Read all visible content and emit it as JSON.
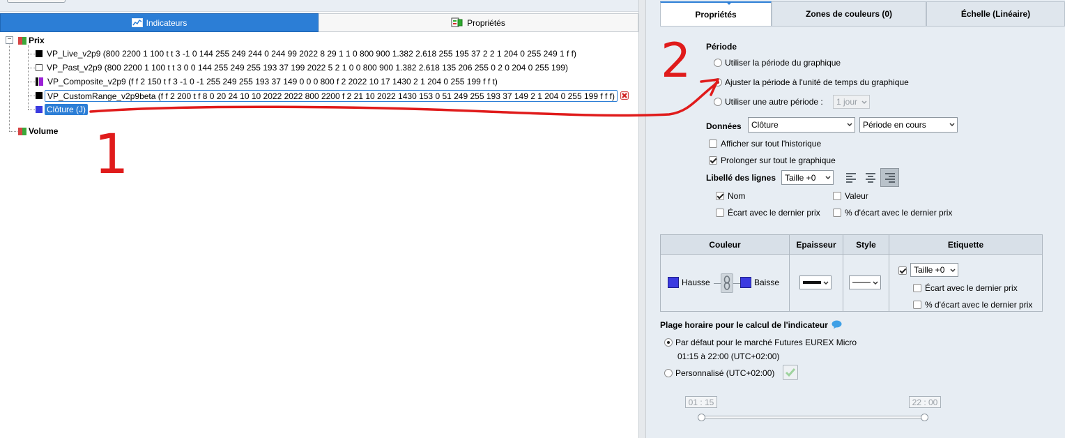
{
  "left_tabs": {
    "indicators": "Indicateurs",
    "properties": "Propriétés"
  },
  "tree": {
    "prix_label": "Prix",
    "prix_expander": "−",
    "volume_label": "Volume",
    "items": [
      {
        "label": "VP_Live_v2p9 (800 2200 1 100 t t 3 -1 0 144 255 249 244 0 244 99 2022 8 29 1 1 0 800 900 1.382 2.618 255 195 37 2 2 1 204 0 255 249 1 f f)",
        "swatch": "#000000"
      },
      {
        "label": "VP_Past_v2p9 (800 2200 1 100 t t 3 0 0 144 255 249 255 193 37 199 2022 5 2 1 0 0 800 900 1.382 2.618 135 206 255 0 2 0 204 0 255 199)",
        "swatch": "#ffffff"
      },
      {
        "label": "VP_Composite_v2p9 (f f 2 150 t f 3 -1 0 -1 255 249 255 193 37 149 0 0 0 800 f 2 2022 10 17 1430 2 1 204 0 255 199 f f t)",
        "swatch": "#9b20d6"
      },
      {
        "label": "VP_CustomRange_v2p9beta (f f 2 200 t f 8 0 20 24 10 10 2022 2022 800 2200 f 2 21 10 2022 1430 153 0 51 249 255 193 37 149 2 1 204 0 255 199 f f f)",
        "swatch": "#000000"
      },
      {
        "label": "Clôture (J)",
        "swatch": "#3b3be0"
      }
    ]
  },
  "right_tabs": {
    "props": "Propriétés",
    "zones": "Zones de couleurs (0)",
    "echelle": "Échelle (Linéaire)"
  },
  "periode": {
    "label": "Période",
    "opt1": "Utiliser la période du graphique",
    "opt2": "Ajuster la période à l'unité de temps du graphique",
    "opt3": "Utiliser une autre période :",
    "opt3_value": "1 jour"
  },
  "donnees": {
    "label": "Données",
    "source": "Clôture",
    "period": "Période en cours",
    "history": "Afficher sur tout l'historique",
    "extend": "Prolonger sur tout le graphique"
  },
  "libelle": {
    "label": "Libellé des lignes",
    "size": "Taille +0",
    "nom": "Nom",
    "valeur": "Valeur",
    "ecart": "Écart avec le dernier prix",
    "pct_ecart": "% d'écart avec le dernier prix"
  },
  "style_table": {
    "h_couleur": "Couleur",
    "h_epaisseur": "Epaisseur",
    "h_style": "Style",
    "h_etiquette": "Etiquette",
    "hausse": "Hausse",
    "baisse": "Baisse",
    "hausse_color": "#3b3be0",
    "baisse_color": "#3b3be0",
    "etiquette_size": "Taille +0",
    "etiquette_ecart": "Écart avec le dernier prix",
    "etiquette_pct": "% d'écart avec le dernier prix"
  },
  "plage": {
    "label": "Plage horaire pour le calcul de l'indicateur",
    "default": "Par défaut pour le marché Futures EUREX Micro",
    "default_hours": "01:15 à 22:00 (UTC+02:00)",
    "custom": "Personnalisé (UTC+02:00)",
    "start": "01 : 15",
    "end": "22 : 00"
  },
  "annotations": {
    "one": "1",
    "two": "2",
    "color": "#e01b1b"
  }
}
